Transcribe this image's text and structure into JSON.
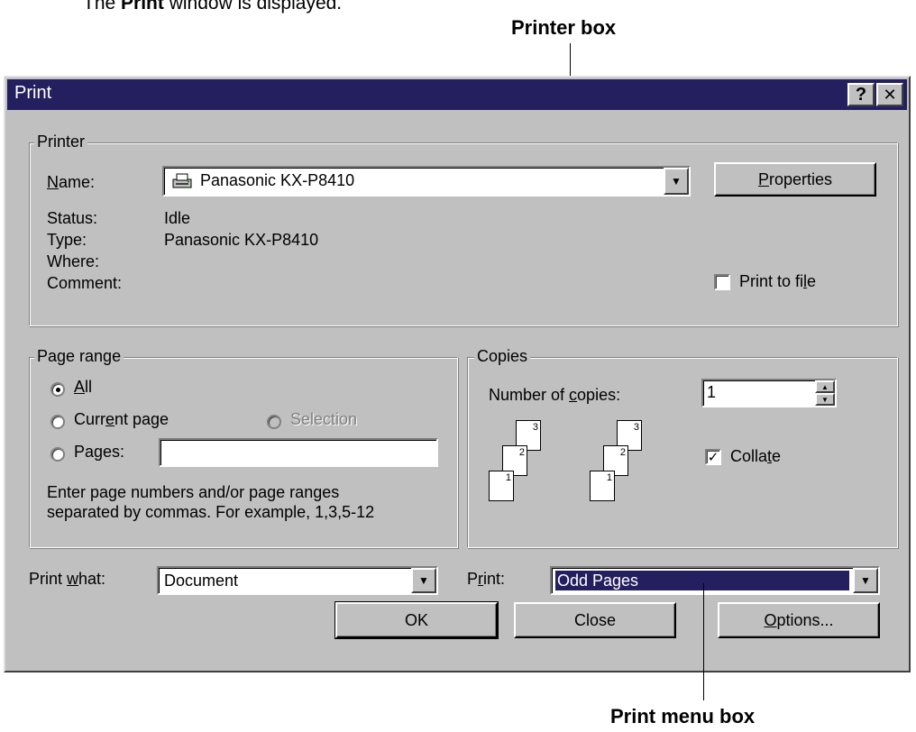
{
  "intro": {
    "prefix": "The ",
    "bold": "Print",
    "suffix": " window is displayed."
  },
  "callouts": {
    "printer_box": "Printer box",
    "print_menu_box": "Print menu box"
  },
  "window": {
    "title": "Print",
    "help_glyph": "?",
    "close_glyph": "✕"
  },
  "printer": {
    "legend": "Printer",
    "name_label": "Name:",
    "name_value": "Panasonic KX-P8410",
    "properties_label": "Properties",
    "status_label": "Status:",
    "status_value": "Idle",
    "type_label": "Type:",
    "type_value": "Panasonic KX-P8410",
    "where_label": "Where:",
    "where_value": "",
    "comment_label": "Comment:",
    "comment_value": "",
    "print_to_file_label": "Print to file",
    "print_to_file_checked": false
  },
  "page_range": {
    "legend": "Page range",
    "all_label": "All",
    "current_page_label": "Current page",
    "selection_label": "Selection",
    "pages_label": "Pages:",
    "pages_value": "",
    "selected": "All",
    "hint_line1": "Enter page numbers and/or page ranges",
    "hint_line2": "separated by commas.  For example, 1,3,5-12"
  },
  "copies": {
    "legend": "Copies",
    "number_label": "Number of copies:",
    "number_value": "1",
    "collate_label": "Collate",
    "collate_checked": true,
    "page_numbers": [
      "3",
      "2",
      "1"
    ]
  },
  "footer": {
    "print_what_label": "Print what:",
    "print_what_value": "Document",
    "print_label": "Print:",
    "print_value": "Odd Pages",
    "ok_label": "OK",
    "close_label": "Close",
    "options_label": "Options..."
  },
  "colors": {
    "titlebar": "#24205f",
    "face": "#c0c0c0",
    "selection": "#24205f"
  },
  "icons": [
    "printer-icon",
    "dropdown-arrow-icon",
    "spinner-up-icon",
    "spinner-down-icon",
    "check-icon",
    "help-icon",
    "close-icon"
  ]
}
